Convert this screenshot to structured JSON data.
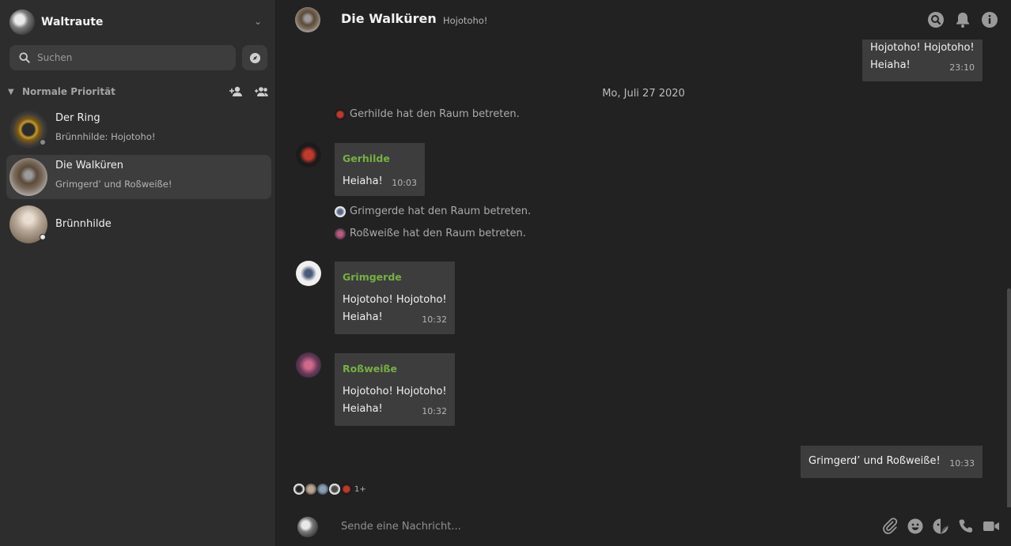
{
  "user": {
    "name": "Waltraute"
  },
  "search": {
    "placeholder": "Suchen"
  },
  "section": {
    "label": "Normale Priorität"
  },
  "rooms": [
    {
      "name": "Der Ring",
      "preview": "Brünnhilde: Hojotoho!"
    },
    {
      "name": "Die Walküren",
      "preview": "Grimgerd’ und Roßweiße!"
    },
    {
      "name": "Brünnhilde",
      "preview": ""
    }
  ],
  "header": {
    "title": "Die Walküren",
    "topic": "Hojotoho!"
  },
  "timeline": {
    "top_own_message": {
      "line1": "Hojotoho! Hojotoho!",
      "line2": "Heiaha!",
      "time": "23:10"
    },
    "date_separator": "Mo, Juli 27 2020",
    "events": [
      "Gerhilde hat den Raum betreten.",
      "Grimgerde hat den Raum betreten.",
      "Roßweiße hat den Raum betreten."
    ],
    "messages": [
      {
        "sender": "Gerhilde",
        "line1": "Heiaha!",
        "line2": "",
        "time": "10:03"
      },
      {
        "sender": "Grimgerde",
        "line1": "Hojotoho! Hojotoho!",
        "line2": "Heiaha!",
        "time": "10:32"
      },
      {
        "sender": "Roßweiße",
        "line1": "Hojotoho! Hojotoho!",
        "line2": "Heiaha!",
        "time": "10:32"
      }
    ],
    "own_message": {
      "text": "Grimgerd’ und Roßweiße!",
      "time": "10:33"
    },
    "read_receipts_more": "1+"
  },
  "composer": {
    "placeholder": "Sende eine Nachricht..."
  },
  "colors": {
    "sender": "#76b041",
    "background": "#222222",
    "sidebar": "#2d2d2d",
    "bubble": "#3d3d3d",
    "presence_online": "#e8e8e8"
  }
}
